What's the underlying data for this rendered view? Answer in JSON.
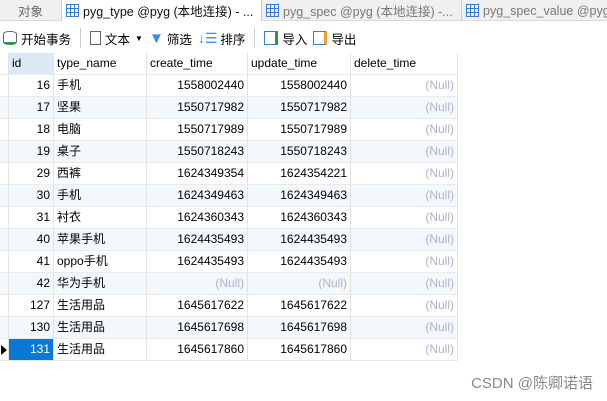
{
  "tabs": [
    {
      "label": "对象"
    },
    {
      "label": "pyg_type @pyg (本地连接) - ..."
    },
    {
      "label": "pyg_spec @pyg (本地连接) -..."
    },
    {
      "label": "pyg_spec_value @pyg"
    }
  ],
  "toolbar": {
    "begin": "开始事务",
    "text": "文本",
    "filter": "筛选",
    "sort": "排序",
    "import": "导入",
    "export": "导出"
  },
  "columns": [
    "id",
    "type_name",
    "create_time",
    "update_time",
    "delete_time"
  ],
  "rows": [
    [
      "16",
      "手机",
      "1558002440",
      "1558002440",
      "(Null)"
    ],
    [
      "17",
      "坚果",
      "1550717982",
      "1550717982",
      "(Null)"
    ],
    [
      "18",
      "电脑",
      "1550717989",
      "1550717989",
      "(Null)"
    ],
    [
      "19",
      "桌子",
      "1550718243",
      "1550718243",
      "(Null)"
    ],
    [
      "29",
      "西裤",
      "1624349354",
      "1624354221",
      "(Null)"
    ],
    [
      "30",
      "手机",
      "1624349463",
      "1624349463",
      "(Null)"
    ],
    [
      "31",
      "衬衣",
      "1624360343",
      "1624360343",
      "(Null)"
    ],
    [
      "40",
      "苹果手机",
      "1624435493",
      "1624435493",
      "(Null)"
    ],
    [
      "41",
      "oppo手机",
      "1624435493",
      "1624435493",
      "(Null)"
    ],
    [
      "42",
      "华为手机",
      "(Null)",
      "(Null)",
      "(Null)"
    ],
    [
      "127",
      "生活用品",
      "1645617622",
      "1645617622",
      "(Null)"
    ],
    [
      "130",
      "生活用品",
      "1645617698",
      "1645617698",
      "(Null)"
    ],
    [
      "131",
      "生活用品",
      "1645617860",
      "1645617860",
      "(Null)"
    ]
  ],
  "watermark": "CSDN @陈卿诺语"
}
